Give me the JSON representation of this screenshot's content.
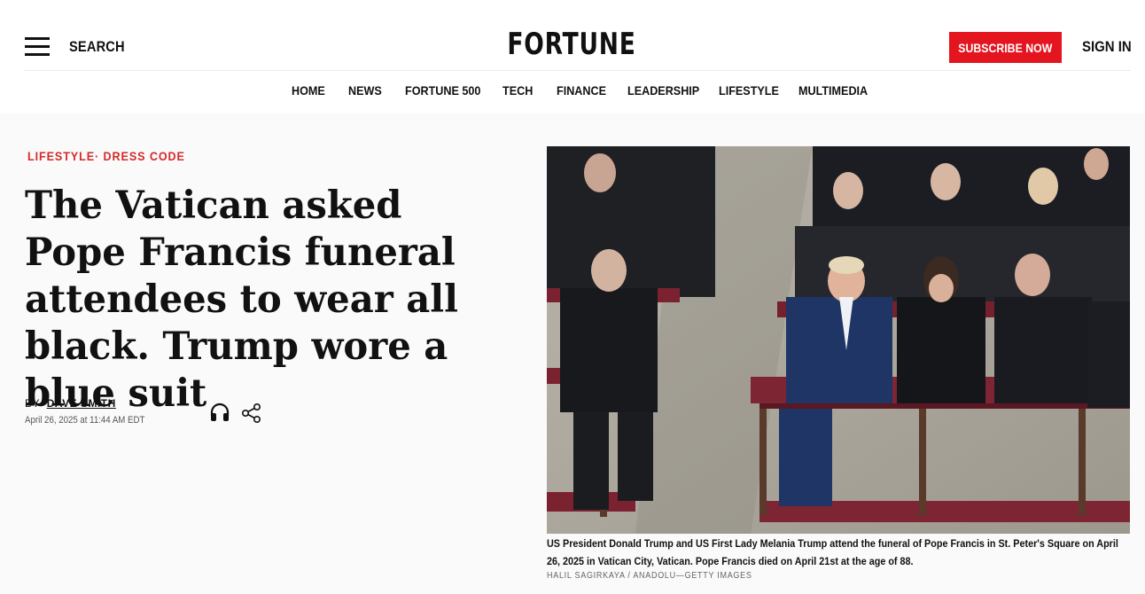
{
  "header": {
    "search_label": "SEARCH",
    "logo_text": "FORTUNE",
    "subscribe_label": "SUBSCRIBE NOW",
    "signin_label": "SIGN IN",
    "accent_color": "#e4151f"
  },
  "nav": {
    "items": [
      "HOME",
      "NEWS",
      "FORTUNE 500",
      "TECH",
      "FINANCE",
      "LEADERSHIP",
      "LIFESTYLE",
      "MULTIMEDIA"
    ]
  },
  "article": {
    "section": "LIFESTYLE",
    "section_separator": "·",
    "subsection": "DRESS CODE",
    "headline": "The Vatican asked Pope Francis funeral attendees to wear all black. Trump wore a blue suit",
    "byline_prefix": "BY",
    "author": "DAVE SMITH",
    "date": "April 26, 2025 at 11:44 AM EDT",
    "icons": [
      "headphones-icon",
      "share-icon"
    ],
    "image": {
      "caption": "US President Donald Trump and US First Lady Melania Trump attend the funeral of Pope Francis in St. Peter's Square on April 26, 2025 in Vatican City, Vatican. Pope Francis died on April 21st at the age of 88.",
      "credit": "HALIL SAGIRKAYA / ANADOLU—GETTY IMAGES"
    }
  }
}
